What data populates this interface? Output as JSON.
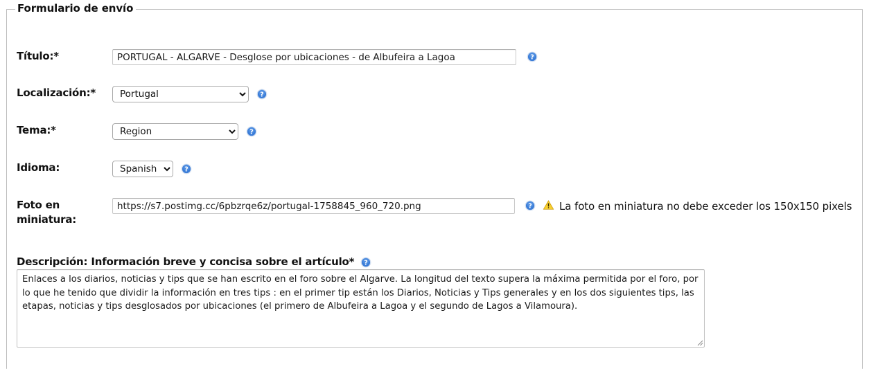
{
  "form": {
    "legend": "Formulario de envío",
    "fields": {
      "title": {
        "label": "Título:*",
        "value": "PORTUGAL - ALGARVE - Desglose por ubicaciones - de Albufeira a Lagoa",
        "placeholder": "",
        "help_icon": "help-circle-icon"
      },
      "location": {
        "label": "Localización:*",
        "value": "Portugal",
        "options": [
          "Portugal"
        ],
        "help_icon": "help-circle-icon"
      },
      "topic": {
        "label": "Tema:*",
        "value": "Region",
        "options": [
          "Region"
        ],
        "help_icon": "help-circle-icon"
      },
      "language": {
        "label": "Idioma:",
        "value": "Spanish",
        "options": [
          "Spanish"
        ],
        "help_icon": "help-circle-icon"
      },
      "thumbnail": {
        "label": "Foto en miniatura:",
        "value": "https://s7.postimg.cc/6pbzrqe6z/portugal-1758845_960_720.png",
        "placeholder": "",
        "help_icon": "help-circle-icon",
        "warning_icon": "warning-triangle-icon",
        "warning_text": "La foto en miniatura no debe exceder los 150x150 pixels"
      },
      "description": {
        "label": "Descripción: Información breve y concisa sobre el artículo*",
        "help_icon": "help-circle-icon",
        "value": "Enlaces a los diarios, noticias y tips que se han escrito en el foro sobre el Algarve. La longitud del texto supera la máxima permitida por el foro, por lo que he tenido que dividir la información en tres tips : en el primer tip están los Diarios, Noticias y Tips generales y en los dos siguientes tips, las etapas, noticias y tips desglosados por ubicaciones (el primero de Albufeira a Lagoa y el segundo de Lagos a Vilamoura).",
        "placeholder": ""
      }
    }
  },
  "colors": {
    "help_icon_blue": "#3b7dd8",
    "warning_yellow": "#f5c518",
    "border_gray": "#bdbdbd",
    "text_black": "#111111"
  }
}
